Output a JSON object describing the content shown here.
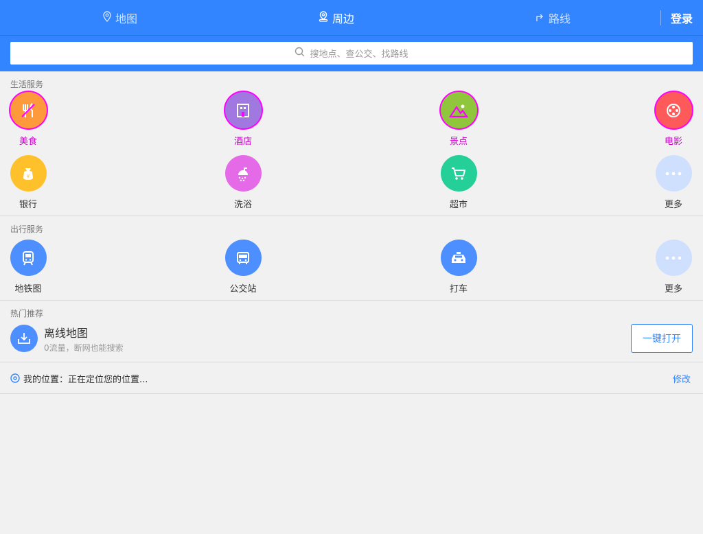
{
  "header": {
    "tabs": [
      {
        "label": "地图",
        "active": false
      },
      {
        "label": "周边",
        "active": true
      },
      {
        "label": "路线",
        "active": false
      }
    ],
    "login_label": "登录",
    "accent_color": "#3385ff"
  },
  "search": {
    "placeholder": "搜地点、查公交、找路线"
  },
  "life_services": {
    "title": "生活服务",
    "items": [
      {
        "label": "美食",
        "icon": "food-icon",
        "color": "#ff9a3c"
      },
      {
        "label": "酒店",
        "icon": "hotel-icon",
        "color": "#a178e0"
      },
      {
        "label": "景点",
        "icon": "scenery-icon",
        "color": "#8fc63b"
      },
      {
        "label": "电影",
        "icon": "movie-icon",
        "color": "#ff5a5a"
      },
      {
        "label": "银行",
        "icon": "bank-icon",
        "color": "#ffc12b"
      },
      {
        "label": "洗浴",
        "icon": "shower-icon",
        "color": "#e46ae8"
      },
      {
        "label": "超市",
        "icon": "cart-icon",
        "color": "#25cf98"
      },
      {
        "label": "更多",
        "icon": "more-icon",
        "color": "#cfe0ff"
      }
    ]
  },
  "travel_services": {
    "title": "出行服务",
    "items": [
      {
        "label": "地铁图",
        "icon": "subway-icon",
        "color": "#4d8fff"
      },
      {
        "label": "公交站",
        "icon": "bus-icon",
        "color": "#4d8fff"
      },
      {
        "label": "打车",
        "icon": "taxi-icon",
        "color": "#4d8fff"
      },
      {
        "label": "更多",
        "icon": "more-icon",
        "color": "#cfe0ff"
      }
    ]
  },
  "hot": {
    "title": "热门推荐",
    "item_title": "离线地图",
    "item_subtitle": "0流量，断网也能搜索",
    "button_label": "一键打开"
  },
  "location": {
    "prefix": "我的位置：",
    "status": "正在定位您的位置...",
    "edit_label": "修改"
  }
}
